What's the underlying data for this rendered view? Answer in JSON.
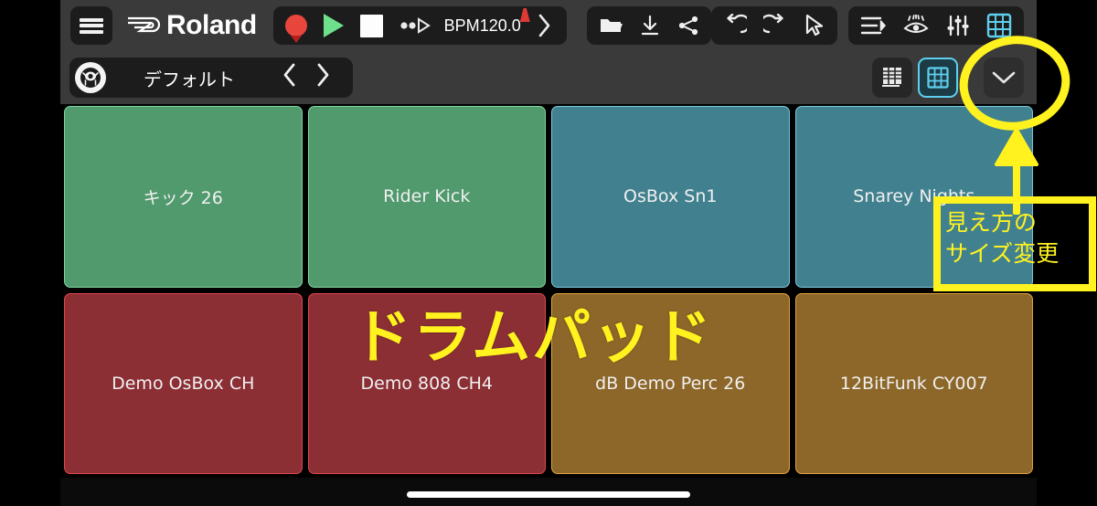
{
  "app": {
    "brand": "Roland",
    "brand_icon": "roland-logo"
  },
  "toolbar": {
    "menu_icon": "hamburger-menu-icon",
    "record_icon": "record-icon",
    "play_icon": "play-icon",
    "stop_icon": "stop-icon",
    "loop_icon": "loop-playback-icon",
    "bpm_label": "BPM",
    "bpm_value": "120.0",
    "metronome_icon": "metronome-icon",
    "bpm_next_icon": "chevron-right-icon",
    "open_icon": "folder-open-icon",
    "download_icon": "download-icon",
    "share_icon": "share-icon",
    "undo_icon": "undo-icon",
    "redo_icon": "redo-icon",
    "pointer_icon": "cursor-pointer-icon",
    "sequencer_icon": "sequencer-icon",
    "eye_icon": "eye-icon",
    "mixer_icon": "mixer-faders-icon",
    "grid_icon": "pad-grid-icon"
  },
  "kitbar": {
    "kit_icon": "drum-kit-icon",
    "kit_name": "デフォルト",
    "prev_icon": "chevron-left-icon",
    "next_icon": "chevron-right-icon",
    "view_list_icon": "list-view-icon",
    "view_grid_icon": "grid-view-icon",
    "collapse_icon": "chevron-down-icon"
  },
  "colors": {
    "green": "#519a6e",
    "green_border": "#7fd6a0",
    "blue": "#41818f",
    "blue_border": "#7cc9dd",
    "red": "#8c2f35",
    "red_border": "#e0464a",
    "amber": "#8d6729",
    "amber_border": "#e2a23c",
    "accent_cyan": "#5ecfee",
    "annotation_yellow": "#fff21f",
    "toolbar_bg": "#3a3a3a"
  },
  "pads": [
    {
      "label": "キック 26",
      "color": "#519a6e",
      "border": "#7fd6a0"
    },
    {
      "label": "Rider Kick",
      "color": "#519a6e",
      "border": "#7fd6a0"
    },
    {
      "label": "OsBox Sn1",
      "color": "#41818f",
      "border": "#7cc9dd"
    },
    {
      "label": "Snarey Nights",
      "color": "#41818f",
      "border": "#7cc9dd"
    },
    {
      "label": "Demo OsBox CH",
      "color": "#8c2f35",
      "border": "#e0464a"
    },
    {
      "label": "Demo 808 CH4",
      "color": "#8c2f35",
      "border": "#e0464a"
    },
    {
      "label": "dB Demo Perc 26",
      "color": "#8d6729",
      "border": "#e2a23c"
    },
    {
      "label": "12BitFunk CY007",
      "color": "#8d6729",
      "border": "#e2a23c"
    }
  ],
  "annotations": {
    "title_overlay": "ドラムパッド",
    "note": "見え方の\nサイズ変更",
    "note_line1": "見え方の",
    "note_line2": "サイズ変更",
    "circle_target": "collapse-chevron-button",
    "arrow_icon": "hand-drawn-up-arrow"
  },
  "system": {
    "home_indicator": "home-indicator"
  }
}
